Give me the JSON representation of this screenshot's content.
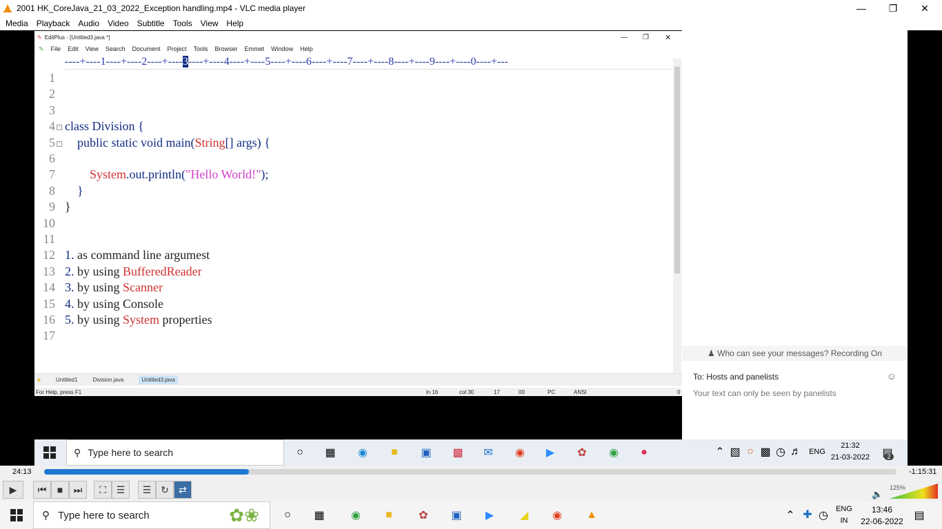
{
  "vlc": {
    "title": "2001 HK_CoreJava_21_03_2022_Exception handling.mp4 - VLC media player",
    "menu": [
      "Media",
      "Playback",
      "Audio",
      "Video",
      "Subtitle",
      "Tools",
      "View",
      "Help"
    ],
    "time_current": "24:13",
    "time_remaining": "-1:15:31",
    "progress_fraction": 0.24,
    "volume_label": "125%"
  },
  "editplus": {
    "title": "EditPlus - [Untitled3.java *]",
    "menu": [
      "File",
      "Edit",
      "View",
      "Search",
      "Document",
      "Project",
      "Tools",
      "Browser",
      "Emmet",
      "Window",
      "Help"
    ],
    "ruler": {
      "before": "----+----1----+----2----+----",
      "cursor": "3",
      "after": "----+----4----+----5----+----6----+----7----+----8----+----9----+----0----+---"
    },
    "lines": [
      {
        "n": "1",
        "parts": []
      },
      {
        "n": "2",
        "parts": []
      },
      {
        "n": "3",
        "parts": []
      },
      {
        "n": "4",
        "fold": true,
        "parts": [
          {
            "t": "class Division {",
            "c": "kw"
          }
        ]
      },
      {
        "n": "5",
        "fold": true,
        "parts": [
          {
            "t": "    public static void main(",
            "c": "kw"
          },
          {
            "t": "String",
            "c": "red"
          },
          {
            "t": "[] args) {",
            "c": "kw"
          }
        ]
      },
      {
        "n": "6",
        "parts": []
      },
      {
        "n": "7",
        "parts": [
          {
            "t": "        ",
            "c": "kw"
          },
          {
            "t": "System",
            "c": "red"
          },
          {
            "t": ".out.println(",
            "c": "kw"
          },
          {
            "t": "\"Hello World!\"",
            "c": "str"
          },
          {
            "t": ");",
            "c": "kw"
          }
        ]
      },
      {
        "n": "8",
        "parts": [
          {
            "t": "    }",
            "c": "kw"
          }
        ]
      },
      {
        "n": "9",
        "parts": [
          {
            "t": "}",
            "c": "plain"
          }
        ]
      },
      {
        "n": "10",
        "parts": []
      },
      {
        "n": "11",
        "parts": []
      },
      {
        "n": "12",
        "parts": [
          {
            "t": "1.",
            "c": "kw"
          },
          {
            "t": " as command line argumest",
            "c": "plain"
          }
        ]
      },
      {
        "n": "13",
        "parts": [
          {
            "t": "2.",
            "c": "kw"
          },
          {
            "t": " by using ",
            "c": "plain"
          },
          {
            "t": "BufferedReader",
            "c": "red"
          }
        ]
      },
      {
        "n": "14",
        "parts": [
          {
            "t": "3.",
            "c": "kw"
          },
          {
            "t": " by using ",
            "c": "plain"
          },
          {
            "t": "Scanner",
            "c": "red"
          }
        ]
      },
      {
        "n": "15",
        "parts": [
          {
            "t": "4.",
            "c": "kw"
          },
          {
            "t": " by using Console",
            "c": "plain"
          }
        ]
      },
      {
        "n": "16",
        "parts": [
          {
            "t": "5.",
            "c": "kw"
          },
          {
            "t": " by using ",
            "c": "plain"
          },
          {
            "t": "System",
            "c": "red"
          },
          {
            "t": " properties",
            "c": "plain"
          }
        ]
      },
      {
        "n": "17",
        "parts": []
      }
    ],
    "tabs": [
      "Untitled1",
      "Division.java",
      "Untitled3.java"
    ],
    "status": {
      "help": "For Help, press F1",
      "ln": "ln 16",
      "col": "col 30",
      "a": "17",
      "b": "00",
      "mode": "PC",
      "enc": "ANSI",
      "z": "0"
    }
  },
  "chat": {
    "who": "Who can see your messages? Recording On",
    "to": "To:  Hosts and panelists",
    "placeholder": "Your text can only be seen by panelists"
  },
  "inner_taskbar": {
    "search": "Type here to search",
    "lang": "ENG",
    "time": "21:32",
    "date": "21-03-2022",
    "notif": "2"
  },
  "outer_taskbar": {
    "search": "Type here to search",
    "lang1": "ENG",
    "lang2": "IN",
    "time": "13:46",
    "date": "22-06-2022"
  },
  "colors": {
    "keyword": "#102c84",
    "type": "#d03030",
    "string": "#d040c8",
    "accent": "#1f78d1"
  }
}
